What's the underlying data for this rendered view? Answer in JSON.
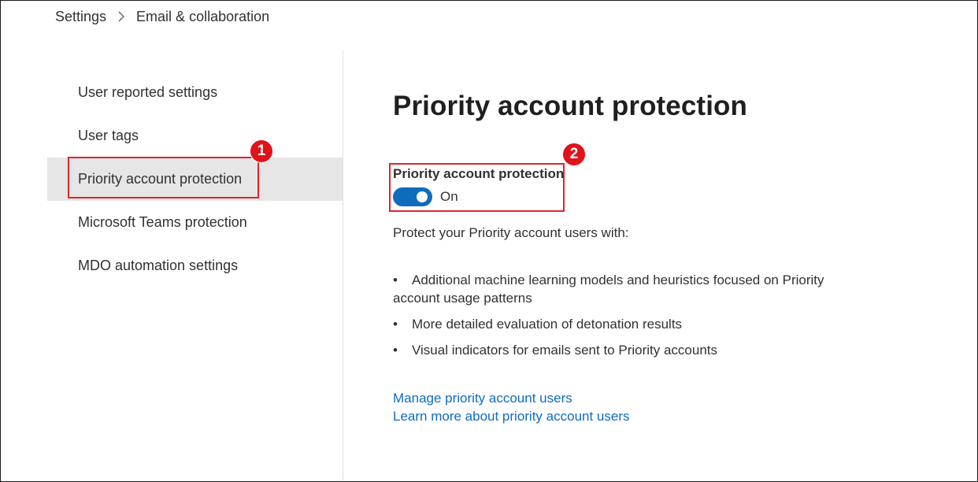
{
  "breadcrumb": {
    "items": [
      "Settings",
      "Email & collaboration"
    ]
  },
  "sidebar": {
    "items": [
      {
        "label": "User reported settings"
      },
      {
        "label": "User tags"
      },
      {
        "label": "Priority account protection",
        "selected": true
      },
      {
        "label": "Microsoft Teams protection"
      },
      {
        "label": "MDO automation settings"
      }
    ]
  },
  "annotations": {
    "badge_1": "1",
    "badge_2": "2",
    "color": "#e0121a"
  },
  "main": {
    "title": "Priority account protection",
    "toggle": {
      "label": "Priority account protection",
      "state": "On",
      "checked": true,
      "accent": "#0f6cbd"
    },
    "intro": "Protect your Priority account users with:",
    "bullets": [
      "Additional machine learning models and heuristics focused on Priority account usage patterns",
      "More detailed evaluation of detonation results",
      "Visual indicators for emails sent to Priority accounts"
    ],
    "links": [
      "Manage priority account users",
      "Learn more about priority account users"
    ]
  }
}
